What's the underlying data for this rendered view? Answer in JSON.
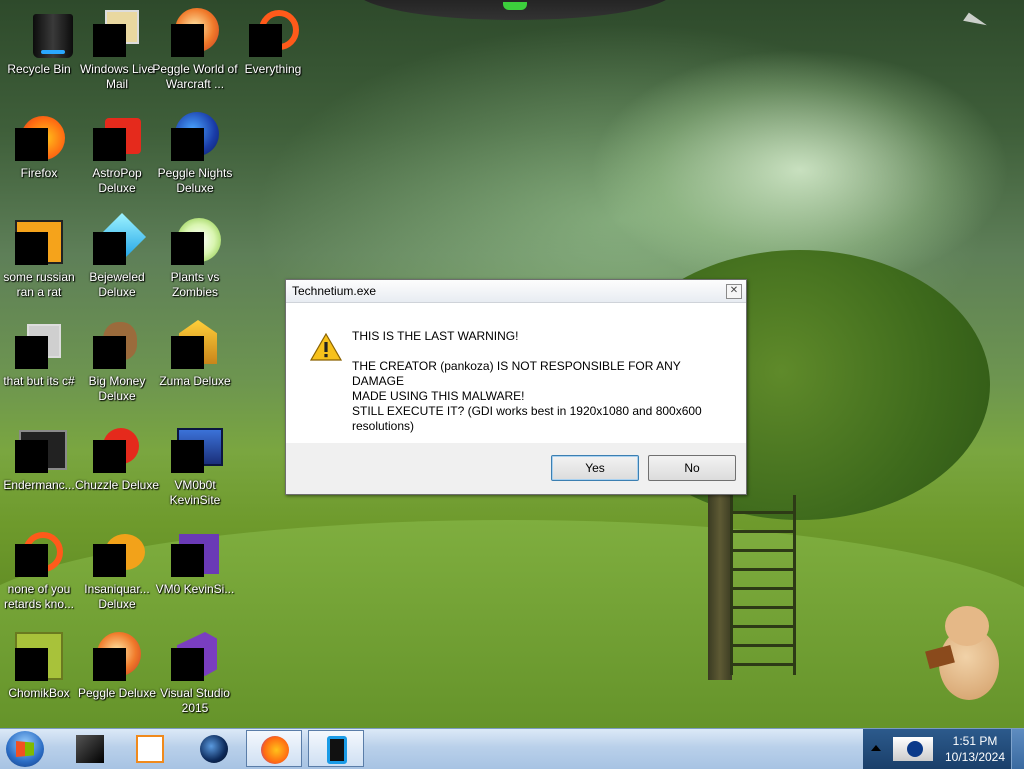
{
  "desktop_icons": [
    {
      "label": "Recycle Bin",
      "icon": "recycle-bin-icon"
    },
    {
      "label": "Windows Live Mail",
      "icon": "mail-icon"
    },
    {
      "label": "Peggle World of Warcraft ...",
      "icon": "peggle-wow-icon"
    },
    {
      "label": "Everything",
      "icon": "everything-search-icon"
    },
    {
      "label": "Firefox",
      "icon": "firefox-icon"
    },
    {
      "label": "AstroPop Deluxe",
      "icon": "astropop-icon"
    },
    {
      "label": "Peggle Nights Deluxe",
      "icon": "peggle-nights-icon"
    },
    {
      "label": "some russian ran a rat",
      "icon": "application-icon"
    },
    {
      "label": "Bejeweled Deluxe",
      "icon": "bejeweled-icon"
    },
    {
      "label": "Plants vs Zombies",
      "icon": "plants-vs-zombies-icon"
    },
    {
      "label": "that but its c#",
      "icon": "stacked-windows-icon"
    },
    {
      "label": "Big Money Deluxe",
      "icon": "money-bag-icon"
    },
    {
      "label": "Zuma Deluxe",
      "icon": "zuma-icon"
    },
    {
      "label": "Endermanc...",
      "icon": "terminal-icon"
    },
    {
      "label": "Chuzzle Deluxe",
      "icon": "chuzzle-icon"
    },
    {
      "label": "VM0b0t KevinSite",
      "icon": "vm-icon"
    },
    {
      "label": "none of you retards kno...",
      "icon": "red-circle-icon"
    },
    {
      "label": "Insaniquar... Deluxe",
      "icon": "fish-icon"
    },
    {
      "label": "VM0 KevinSi...",
      "icon": "vm-purple-icon"
    },
    {
      "label": "ChomikBox",
      "icon": "chomikbox-icon"
    },
    {
      "label": "Peggle Deluxe",
      "icon": "peggle-icon"
    },
    {
      "label": "Visual Studio 2015",
      "icon": "visual-studio-icon"
    }
  ],
  "dialog": {
    "title": "Technetium.exe",
    "close_glyph": "✕",
    "line1": "THIS IS THE LAST WARNING!",
    "line2": "THE CREATOR (pankoza) IS NOT RESPONSIBLE FOR ANY DAMAGE",
    "line3": "MADE USING THIS MALWARE!",
    "line4": "STILL EXECUTE IT? (GDI works best in 1920x1080 and 800x600",
    "line5": "resolutions)",
    "yes_label": "Yes",
    "no_label": "No"
  },
  "taskbar": {
    "items": [
      {
        "name": "start-button"
      },
      {
        "name": "black-box-app"
      },
      {
        "name": "media-player"
      },
      {
        "name": "dark-orb-app"
      },
      {
        "name": "firefox",
        "active": true
      },
      {
        "name": "phone-app",
        "active": true
      }
    ],
    "clock_time": "1:51 PM",
    "clock_date": "10/13/2024"
  },
  "colors": {
    "accent": "#3c7fb1",
    "taskbar": "#b9d0ea",
    "tray": "#1a3f6a"
  }
}
